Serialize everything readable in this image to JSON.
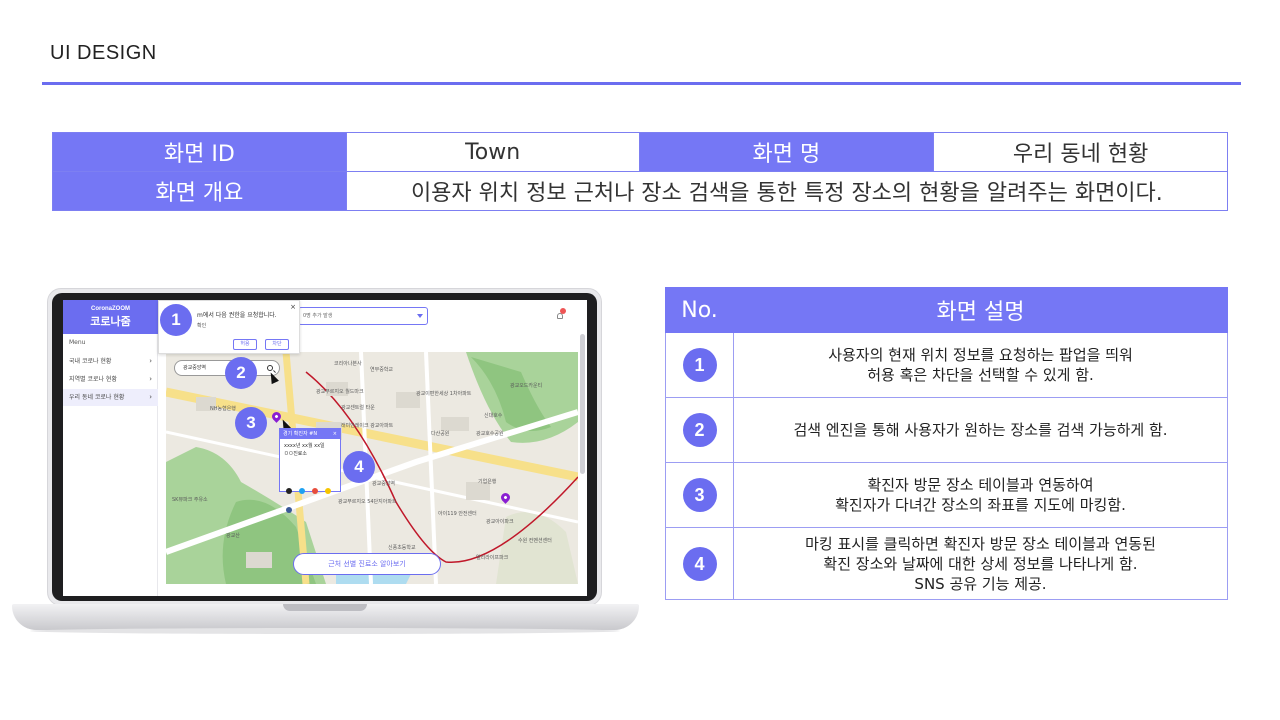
{
  "header": {
    "title": "UI DESIGN"
  },
  "info_table": {
    "screen_id_label": "화면 ID",
    "screen_id_value": "Town",
    "screen_name_label": "화면 명",
    "screen_name_value": "우리 동네 현황",
    "overview_label": "화면 개요",
    "overview_value": "이용자 위치 정보 근처나 장소 검색을 통한 특정 장소의 현황을 알려주는 화면이다."
  },
  "mockup": {
    "logo_top": "CoronaZOOM",
    "logo_bottom": "코로나줌",
    "menu_heading": "Menu",
    "menu_items": [
      {
        "label": "국내 코로나 현황",
        "chevron": "›"
      },
      {
        "label": "지역별 코로나 현황",
        "chevron": "›"
      },
      {
        "label": "우리 동네 코로나 현황",
        "chevron": "›"
      }
    ],
    "permission_popup": {
      "text": "m에서 다음 권한을 요청합니다.",
      "sub": "확인",
      "allow_label": "허용",
      "block_label": "차단",
      "close_icon": "×"
    },
    "top_select_text": "0명 추가 발생",
    "search_text": "광교중앙역",
    "marker_card": {
      "title": "경기 확진자 #N",
      "close_icon": "×",
      "date_line": "xxxx년 xx월 xx일",
      "place_line": "ㅁㅁ진료소"
    },
    "clinic_button_label": "근처 선별 진료소 알아보기",
    "map_labels": [
      "코리아나본사",
      "연무중학교",
      "광교푸르지오 월드마크",
      "광교센트럴 타운",
      "광교오드카운티",
      "광교이편한세상 1차아파트",
      "NH농협은행",
      "래미안레이크 광교아파트",
      "다산공원",
      "신대호수",
      "광교호수공원",
      "광교아이파크",
      "SK뷰파크 주유소",
      "광교푸르지오 54단지아파트",
      "광교중앙역",
      "아이119 안전센터",
      "기업은행",
      "광교산",
      "신풍초등학교",
      "엘리라이프파크",
      "수원 컨벤션센터"
    ],
    "badge_numbers": [
      "1",
      "2",
      "3",
      "4"
    ]
  },
  "desc_table": {
    "col_no": "No.",
    "col_desc": "화면 설명",
    "rows": [
      {
        "no": "1",
        "lines": [
          "사용자의 현재 위치 정보를 요청하는 팝업을 띄워",
          "허용 혹은 차단을 선택할 수 있게 함."
        ]
      },
      {
        "no": "2",
        "lines": [
          "검색 엔진을 통해 사용자가 원하는 장소를 검색 가능하게 함."
        ]
      },
      {
        "no": "3",
        "lines": [
          "확진자 방문 장소 테이블과 연동하여",
          "확진자가 다녀간 장소의 좌표를 지도에 마킹함."
        ]
      },
      {
        "no": "4",
        "lines": [
          "마킹 표시를 클릭하면 확진자 방문 장소 테이블과 연동된",
          "확진 장소와 날짜에 대한 상세 정보를 나타나게 함.",
          "SNS 공유 기능 제공."
        ]
      }
    ]
  },
  "colors": {
    "accent": "#6b6df0",
    "header_fill": "#7577f5",
    "pin": "#8a1fd2",
    "route": "#c0182a"
  },
  "icons": [
    "search-icon",
    "close-icon",
    "chevron-right-icon",
    "bell-icon",
    "map-pin-icon",
    "cursor-icon",
    "dropdown-arrow-icon"
  ]
}
